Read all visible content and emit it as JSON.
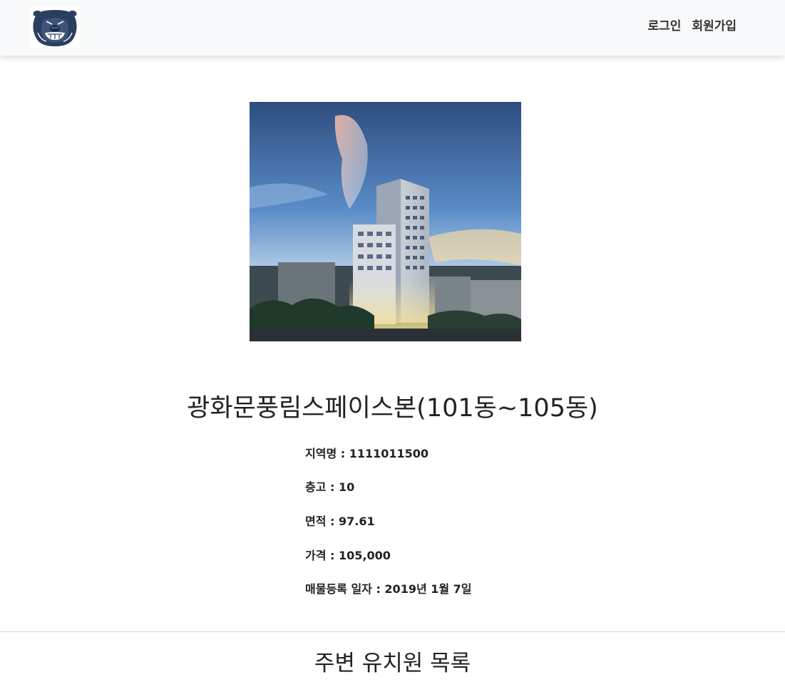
{
  "header": {
    "logo_icon": "bulldog-logo-icon",
    "nav": {
      "login_label": "로그인",
      "signup_label": "회원가입"
    }
  },
  "listing": {
    "image_icon": "building-photo",
    "title": "광화문풍림스페이스본(101동~105동)",
    "region": "지역명 : 1111011500",
    "floors": "층고 : 10",
    "area": "면적 : 97.61",
    "price": "가격 : 105,000",
    "registered": "매물등록 일자 : 2019년 1월 7일"
  },
  "kindergartens": {
    "section_title": "주변 유치원 목록"
  },
  "colors": {
    "navbar_bg": "#f8f9fa",
    "logo_navy": "#2c3e60",
    "text": "#222222"
  }
}
